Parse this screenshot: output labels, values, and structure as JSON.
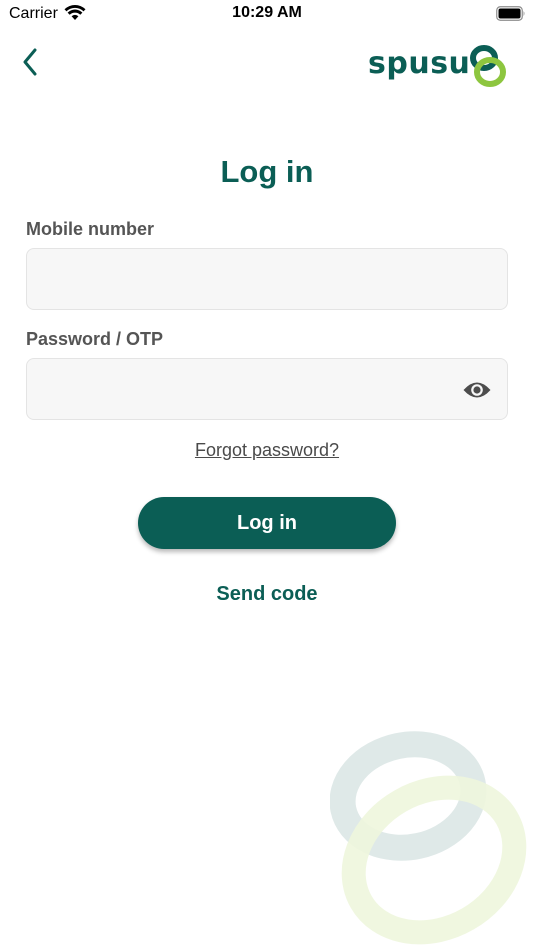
{
  "status_bar": {
    "carrier": "Carrier",
    "time": "10:29 AM"
  },
  "header": {
    "back_icon": "chevron-left-icon",
    "logo_text": "spusu"
  },
  "form": {
    "title": "Log in",
    "mobile_label": "Mobile number",
    "mobile_value": "",
    "password_label": "Password / OTP",
    "password_value": "",
    "password_toggle_icon": "eye-icon",
    "forgot_password": "Forgot password?",
    "login_button": "Log in",
    "send_code": "Send code"
  },
  "colors": {
    "brand": "#0b5e55",
    "accent": "#8dc63f",
    "input_bg": "#f7f7f7",
    "label": "#555555"
  }
}
